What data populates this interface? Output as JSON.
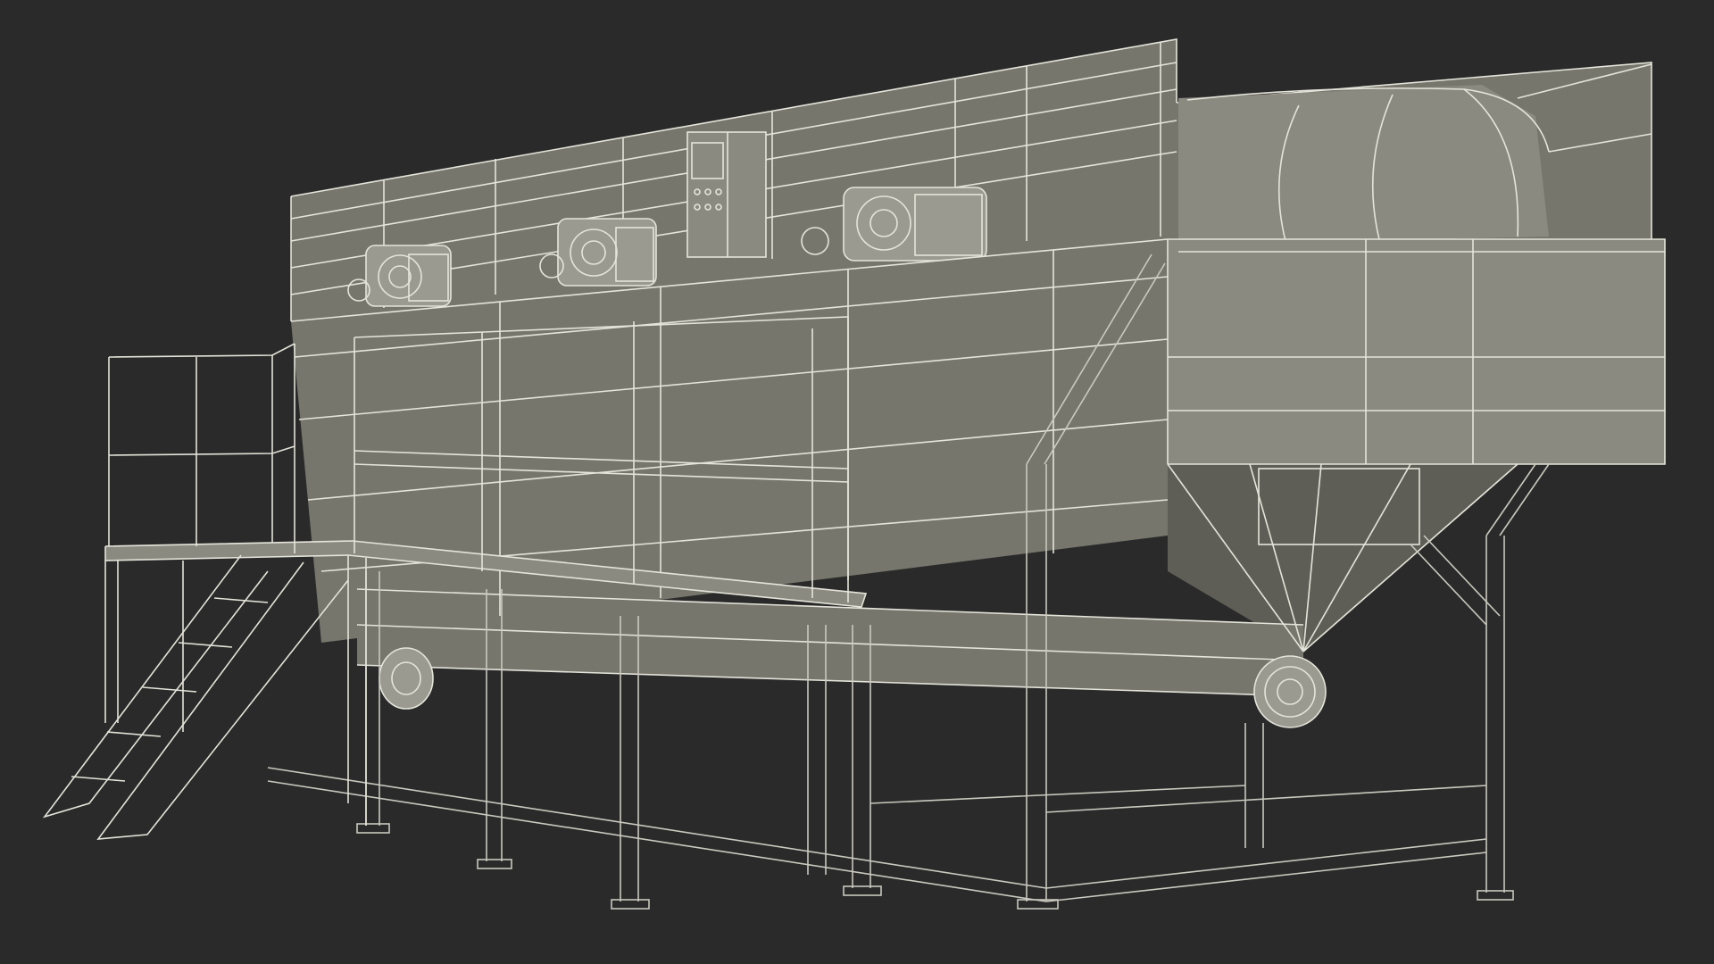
{
  "scene": {
    "subject_icon": "industrial-hopper-conveyor-wireframe-icon",
    "colors": {
      "background": "#2a2a2a",
      "surface": "#76766c",
      "surface_light": "#8a8a80",
      "surface_dark": "#5e5e56",
      "wire": "#e4e4da",
      "wire_faint": "#c9c9bf",
      "motor": "#9a9a90"
    }
  }
}
